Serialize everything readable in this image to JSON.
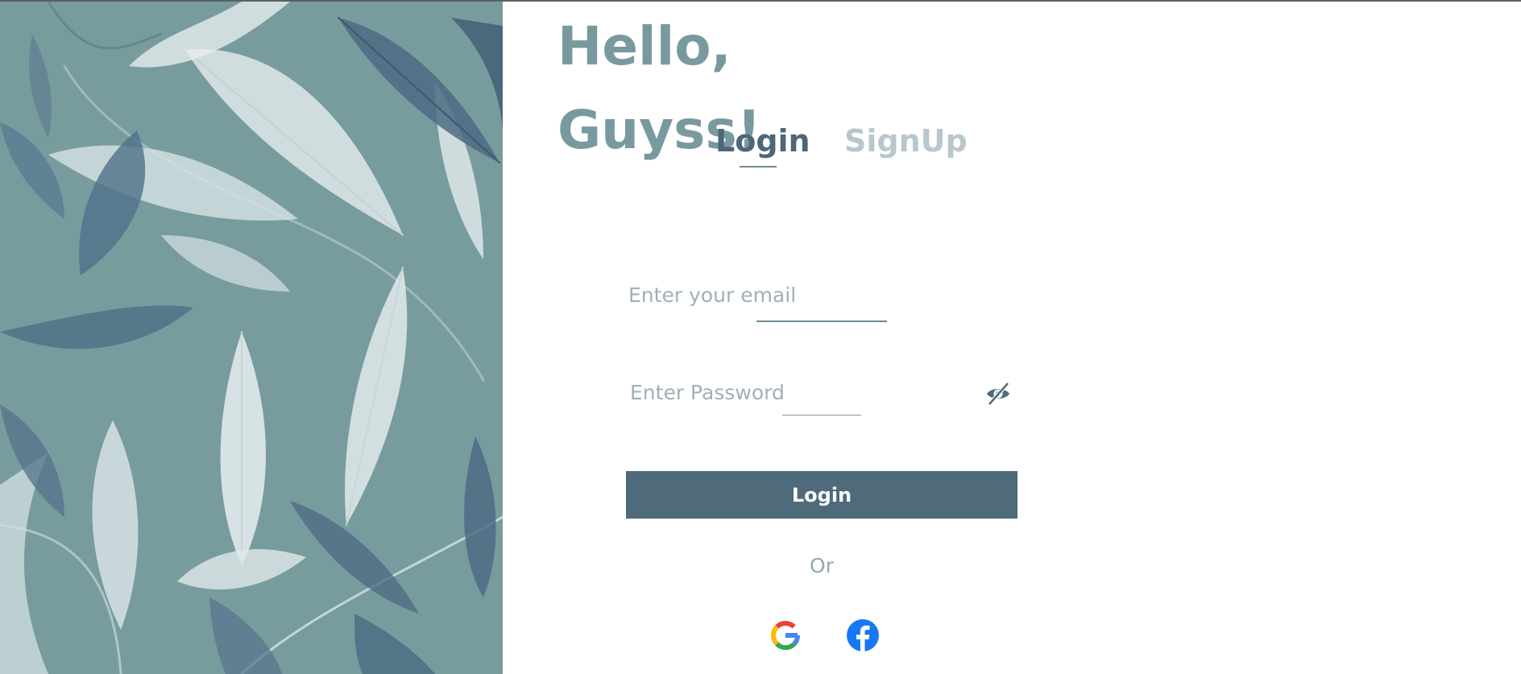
{
  "greeting": {
    "line1": "Hello,",
    "line2": "Guyss!"
  },
  "tabs": [
    {
      "label": "Login",
      "active": true
    },
    {
      "label": "SignUp",
      "active": false
    }
  ],
  "form": {
    "email_placeholder": "Enter your email",
    "email_value": "",
    "password_placeholder": "Enter Password",
    "password_value": "",
    "password_toggle_icon": "eye-slash-icon",
    "submit_label": "Login",
    "divider_text": "Or"
  },
  "social": [
    {
      "name": "google",
      "icon": "google-icon"
    },
    {
      "name": "facebook",
      "icon": "facebook-icon"
    }
  ],
  "colors": {
    "accent": "#4e6a7b",
    "greeting": "#789a9f",
    "panel": "#789c9e",
    "inactive_tab": "#b8c7cd"
  }
}
